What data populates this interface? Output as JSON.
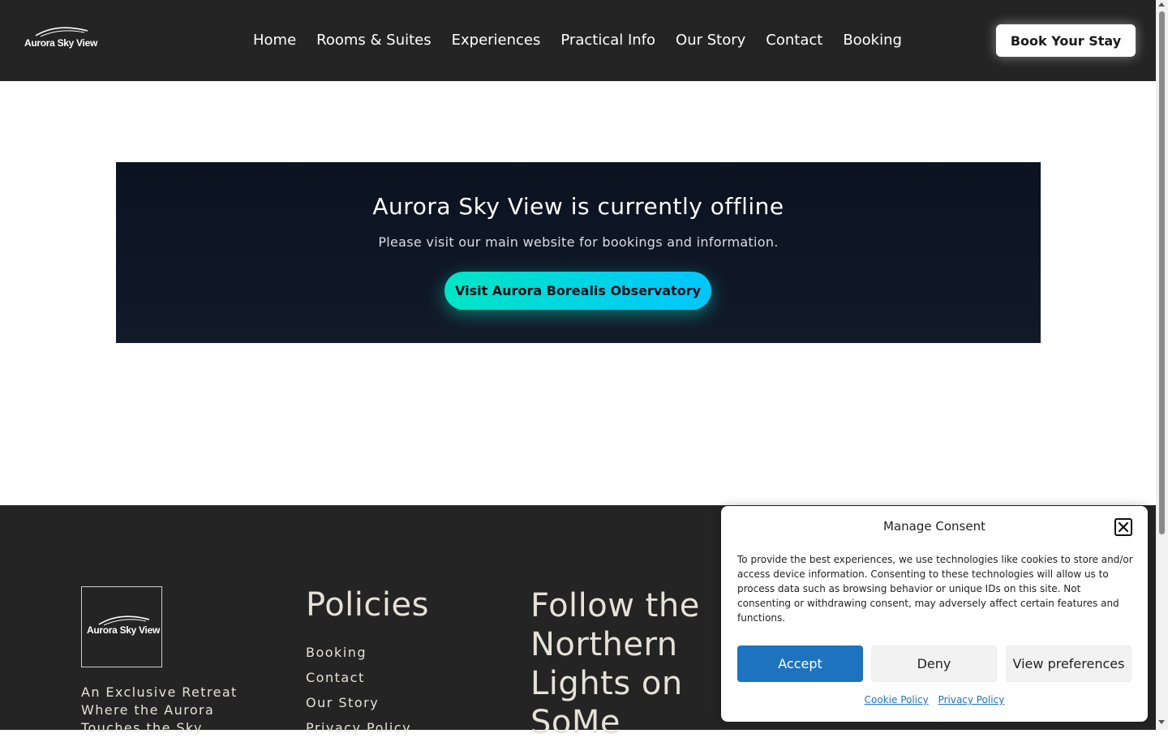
{
  "header": {
    "logo_text": "Aurora Sky View",
    "nav": [
      "Home",
      "Rooms & Suites",
      "Experiences",
      "Practical Info",
      "Our Story",
      "Contact",
      "Booking"
    ],
    "cta_label": "Book Your Stay"
  },
  "offline": {
    "title": "Aurora Sky View is currently offline",
    "message": "Please visit our main website for bookings and information.",
    "button_label": "Visit Aurora Borealis Observatory"
  },
  "footer": {
    "logo_text": "Aurora Sky View",
    "tagline": "An Exclusive Retreat Where the Aurora Touches the Sky",
    "policies_title": "Policies",
    "policy_links": [
      "Booking",
      "Contact",
      "Our Story",
      "Privacy Policy"
    ],
    "follow_title": "Follow the Northern Lights on SoMe"
  },
  "consent": {
    "title": "Manage Consent",
    "body": "To provide the best experiences, we use technologies like cookies to store and/or access device information. Consenting to these technologies will allow us to process data such as browsing behavior or unique IDs on this site. Not consenting or withdrawing consent, may adversely affect certain features and functions.",
    "accept_label": "Accept",
    "deny_label": "Deny",
    "preferences_label": "View preferences",
    "cookie_policy_label": "Cookie Policy",
    "privacy_policy_label": "Privacy Policy"
  },
  "colors": {
    "header_bg": "#242424",
    "accent_gradient_start": "#00e5c4",
    "accent_gradient_end": "#00c6ff",
    "consent_accept": "#1e73be"
  }
}
